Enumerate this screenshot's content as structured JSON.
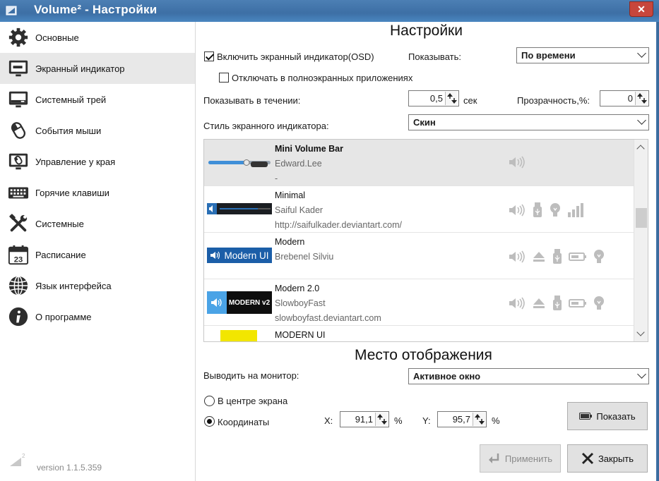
{
  "window": {
    "title": "Volume² - Настройки"
  },
  "sidebar": {
    "items": [
      {
        "label": "Основные",
        "icon": "gear-icon"
      },
      {
        "label": "Экранный индикатор",
        "icon": "monitor-icon"
      },
      {
        "label": "Системный трей",
        "icon": "tray-icon"
      },
      {
        "label": "События мыши",
        "icon": "mouse-icon"
      },
      {
        "label": "Управление у края",
        "icon": "screen-edge-icon"
      },
      {
        "label": "Горячие клавиши",
        "icon": "keyboard-icon"
      },
      {
        "label": "Системные",
        "icon": "tools-icon"
      },
      {
        "label": "Расписание",
        "icon": "calendar-icon"
      },
      {
        "label": "Язык интерфейса",
        "icon": "globe-icon"
      },
      {
        "label": "О программе",
        "icon": "info-icon"
      }
    ],
    "active_index": 1,
    "calendar_day": "23",
    "version": "version 1.1.5.359"
  },
  "settings": {
    "title": "Настройки",
    "enable_osd_label": "Включить экранный индикатор(OSD)",
    "enable_osd_checked": true,
    "show_label": "Показывать:",
    "show_value": "По времени",
    "disable_fullscreen_label": "Отключать в полноэкранных приложениях",
    "disable_fullscreen_checked": false,
    "duration_label": "Показывать в течении:",
    "duration_value": "0,5",
    "duration_unit": "сек",
    "opacity_label": "Прозрачность,%:",
    "opacity_value": "0",
    "style_label": "Стиль экранного индикатора:",
    "style_value": "Скин"
  },
  "skins": [
    {
      "name": "Mini Volume Bar",
      "author": "Edward.Lee",
      "site": "-",
      "selected": true,
      "features": [
        "speaker-icon"
      ]
    },
    {
      "name": "Minimal",
      "author": "Saiful Kader",
      "site": "http://saifulkader.deviantart.com/",
      "selected": false,
      "features": [
        "speaker-icon",
        "usb-icon",
        "bulb-icon",
        "signal-bars-icon"
      ]
    },
    {
      "name": "Modern",
      "author": "Brebenel Silviu",
      "site": "",
      "selected": false,
      "preview_text": "Modern UI",
      "features": [
        "speaker-icon",
        "eject-icon",
        "usb-icon",
        "battery-icon",
        "bulb-icon"
      ]
    },
    {
      "name": "Modern 2.0",
      "author": "SlowboyFast",
      "site": "slowboyfast.deviantart.com",
      "selected": false,
      "preview_text": "MODERN v2",
      "features": [
        "speaker-icon",
        "eject-icon",
        "usb-icon",
        "battery-icon",
        "bulb-icon"
      ]
    },
    {
      "name": "MODERN UI",
      "author": "",
      "site": "",
      "selected": false,
      "features": []
    }
  ],
  "placement": {
    "title": "Место отображения",
    "monitor_label": "Выводить на монитор:",
    "monitor_value": "Активное окно",
    "center_label": "В центре экрана",
    "coords_label": "Координаты",
    "selected": "coords",
    "x_label": "X:",
    "x_value": "91,1",
    "y_label": "Y:",
    "y_value": "95,7",
    "percent": "%",
    "show_button": "Показать"
  },
  "footer": {
    "apply_button": "Применить",
    "close_button": "Закрыть"
  }
}
